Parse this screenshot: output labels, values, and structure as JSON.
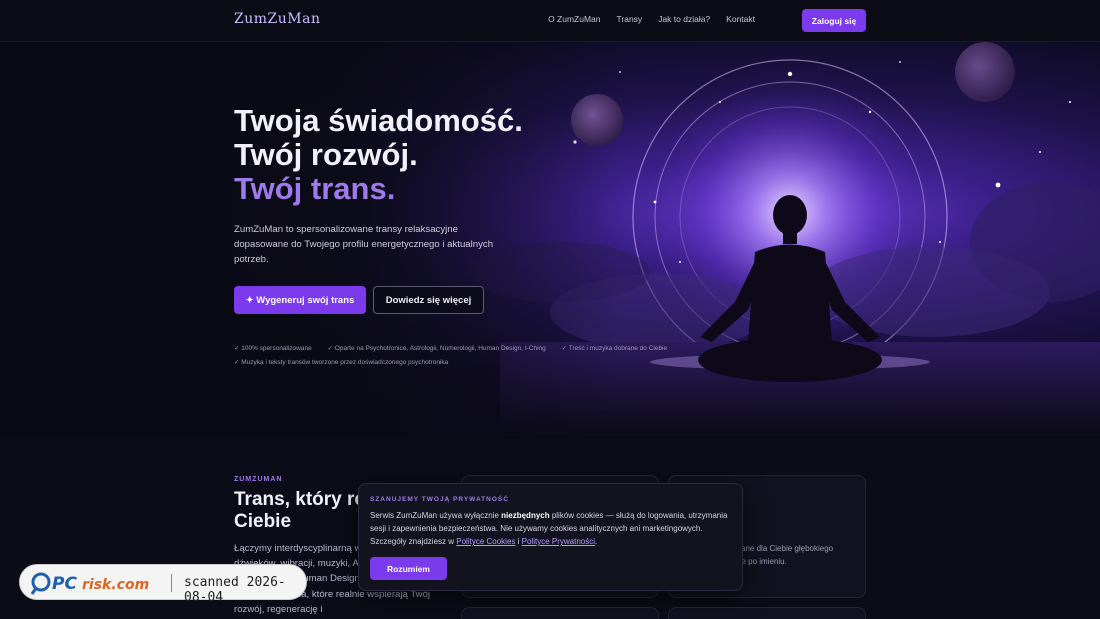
{
  "nav": {
    "logo": "ZumZuMan",
    "links": [
      "O ZumZuMan",
      "Transy",
      "Jak to działa?",
      "Kontakt"
    ],
    "login": "Zaloguj się"
  },
  "hero": {
    "title_line1": "Twoja świadomość.",
    "title_line2": "Twój rozwój.",
    "title_line3": "Twój trans.",
    "lead": "ZumZuMan to spersonalizowane transy relaksacyjne dopasowane do Twojego profilu energetycznego i aktualnych potrzeb.",
    "cta_primary": "✦ Wygeneruj swój trans",
    "cta_secondary": "Dowiedz się więcej",
    "features": [
      "✓ 100% spersonalizowane",
      "✓ Oparte na Psychotronice, Astrologii, Numerologii, Human Design, I-Ching",
      "✓ Treść i muzyka dobrane do Ciebie",
      "✓ Muzyka i teksty transów tworzone przez doświadczonego psychotronika"
    ]
  },
  "section": {
    "eyebrow": "ZUMZUMAN",
    "title": "Trans, który rozumie Ciebie",
    "body": "Łączymy interdyscyplinarną wiedzę z obszaru dźwięków, wibracji, muzyki, Astrologii, Numerologii, Psychotroniki, Human Design i I-Ching, aby tworzyć nagrania, które realnie wspierają Twój rozwój, regenerację i",
    "cards": [
      {
        "title": "",
        "text": ""
      },
      {
        "title": "owadzi",
        "text": "ktora i dopasowane dla Ciebie głębokiego efektu lektor ebie po imieniu."
      }
    ]
  },
  "cookie": {
    "title": "SZANUJEMY TWOJĄ PRYWATNOŚĆ",
    "text_1": "Serwis ZumZuMan używa wyłącznie ",
    "text_bold": "niezbędnych",
    "text_2": " plików cookies — służą do logowania, utrzymania sesji i zapewnienia bezpieczeństwa. Nie używamy cookies analitycznych ani marketingowych. Szczegóły znajdziesz w ",
    "link_cookies": "Polityce Cookies",
    "text_3": " i ",
    "link_privacy": "Polityce Prywatności",
    "text_4": ".",
    "button": "Rozumiem"
  },
  "watermark": {
    "logo": "PCrisk.com",
    "text": "scanned 2026-08-04"
  },
  "colors": {
    "accent": "#7c3aed",
    "accent_text": "#9f7aea",
    "background": "#0a0a14"
  }
}
